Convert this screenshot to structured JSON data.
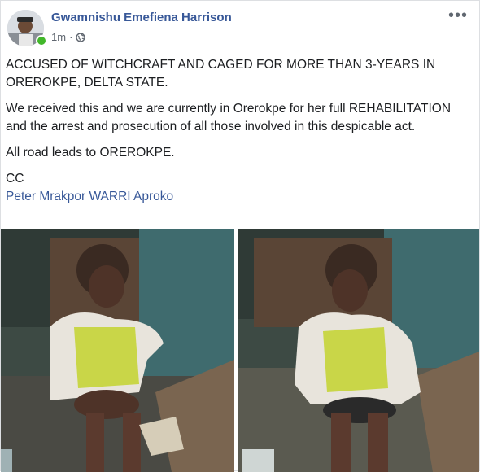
{
  "post": {
    "author": "Gwamnishu Emefiena Harrison",
    "time": "1m",
    "more_label": "•••",
    "paragraphs": [
      "ACCUSED OF WITCHCRAFT AND CAGED FOR MORE THAN 3-YEARS IN OREROKPE, DELTA STATE.",
      "We received this and we are currently in Orerokpe for her full REHABILITATION and the arrest and prosecution of all those involved in this despicable act.",
      "All road leads to OREROKPE."
    ],
    "cc_label": "CC",
    "tag_link": "Peter Mrakpor WARRI Aproko"
  },
  "icons": {
    "privacy": "globe-icon",
    "menu": "more-options-icon",
    "status": "online-status-icon"
  },
  "colors": {
    "link": "#385898",
    "text": "#1c1e21",
    "meta": "#606770",
    "online": "#42b72a"
  }
}
